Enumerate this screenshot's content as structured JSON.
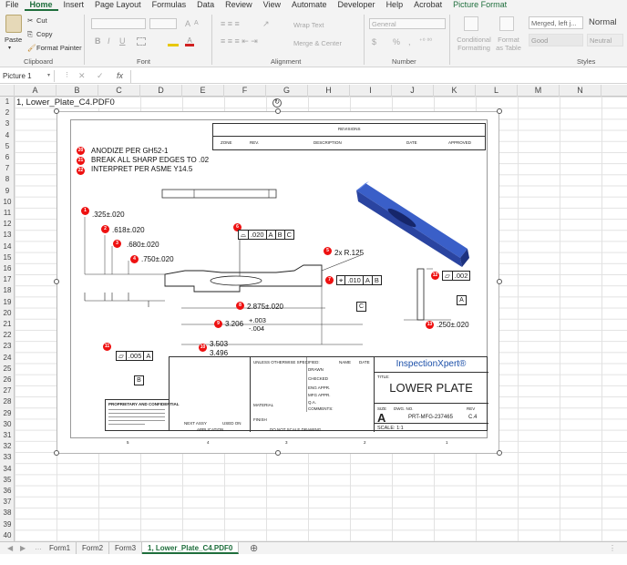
{
  "menu": {
    "items": [
      "File",
      "Home",
      "Insert",
      "Page Layout",
      "Formulas",
      "Data",
      "Review",
      "View",
      "Automate",
      "Developer",
      "Help",
      "Acrobat",
      "Picture Format"
    ],
    "active": "Home"
  },
  "ribbon": {
    "clipboard": {
      "paste": "Paste",
      "cut": "Cut",
      "copy": "Copy",
      "format_painter": "Format Painter",
      "label": "Clipboard"
    },
    "font": {
      "label": "Font",
      "bold": "B",
      "italic": "I",
      "underline": "U",
      "grow": "A",
      "shrink": "A"
    },
    "alignment": {
      "label": "Alignment",
      "wrap": "Wrap Text",
      "merge": "Merge & Center"
    },
    "number": {
      "label": "Number",
      "format": "General",
      "percent": "%",
      "comma": ","
    },
    "styles": {
      "label": "Styles",
      "conditional": "Conditional Formatting",
      "format_table": "Format as Table",
      "merged": "Merged, left j...",
      "normal": "Normal",
      "good": "Good",
      "neutral": "Neutral"
    }
  },
  "formula_bar": {
    "name_box": "Picture 1",
    "fx": "fx",
    "value": ""
  },
  "columns": [
    "A",
    "B",
    "C",
    "D",
    "E",
    "F",
    "G",
    "H",
    "I",
    "J",
    "K",
    "L",
    "M",
    "N"
  ],
  "rows": [
    "1",
    "2",
    "3",
    "4",
    "5",
    "6",
    "7",
    "8",
    "9",
    "10",
    "11",
    "12",
    "13",
    "14",
    "15",
    "16",
    "17",
    "18",
    "19",
    "20",
    "21",
    "22",
    "23",
    "24",
    "25",
    "26",
    "27",
    "28",
    "29",
    "30",
    "31",
    "32",
    "33",
    "34",
    "35",
    "36",
    "37",
    "38",
    "39",
    "40"
  ],
  "cell_a1": "1, Lower_Plate_C4.PDF0",
  "tabs": [
    "Form1",
    "Form2",
    "Form3",
    "1, Lower_Plate_C4.PDF0"
  ],
  "active_tab": "1, Lower_Plate_C4.PDF0",
  "drawing": {
    "revisions": "REVISIONS",
    "rev_cols": [
      "ZONE",
      "REV.",
      "DESCRIPTION",
      "DATE",
      "APPROVED"
    ],
    "notes": [
      "ANODIZE PER GH52-1",
      "BREAK ALL SHARP EDGES TO .02",
      "INTERPRET PER ASME Y14.5"
    ],
    "note_balloons": [
      "20",
      "21",
      "22"
    ],
    "dims": {
      "d1": ".325±.020",
      "d2": ".618±.020",
      "d3": ".680±.020",
      "d4": ".750±.020",
      "d5": "2x R.125",
      "d8": "2.875±.020",
      "d9a": "3.206",
      "d9b": "+.003",
      "d9c": "-.004",
      "d10a": "3.503",
      "d10b": "3.496",
      "d13": ".250±.020"
    },
    "fcf6": [
      ".020",
      "A",
      "B",
      "C"
    ],
    "fcf7": [
      ".010",
      "A",
      "B"
    ],
    "fcf11": [
      ".005",
      "A"
    ],
    "fcf12": [
      ".002"
    ],
    "datums": [
      "A",
      "B",
      "C"
    ],
    "balloons": [
      "1",
      "2",
      "3",
      "4",
      "5",
      "6",
      "7",
      "8",
      "9",
      "10",
      "11",
      "12",
      "13"
    ],
    "title_block": {
      "company": "InspectionXpert®",
      "title_label": "TITLE:",
      "title": "LOWER PLATE",
      "size_label": "SIZE",
      "size": "A",
      "dwg_label": "DWG.  NO.",
      "dwg": "PRT-MFG-237465",
      "rev_label": "REV",
      "rev": "C.4",
      "scale": "SCALE: 1:1",
      "unless": "UNLESS OTHERWISE SPECIFIED:",
      "name": "NAME",
      "date": "DATE",
      "drawn": "DRAWN",
      "checked": "CHECKED",
      "eng": "ENG APPR.",
      "mfg": "MFG APPR.",
      "qa": "Q.A.",
      "comments": "COMMENTS:",
      "material": "MATERIAL",
      "finish": "FINISH",
      "next_assy": "NEXT ASSY",
      "used_on": "USED ON",
      "application": "APPLICATION",
      "do_not_scale": "DO NOT SCALE DRAWING",
      "proprietary": "PROPRIETARY AND CONFIDENTIAL",
      "zones": [
        "5",
        "4",
        "3",
        "2",
        "1"
      ]
    }
  }
}
